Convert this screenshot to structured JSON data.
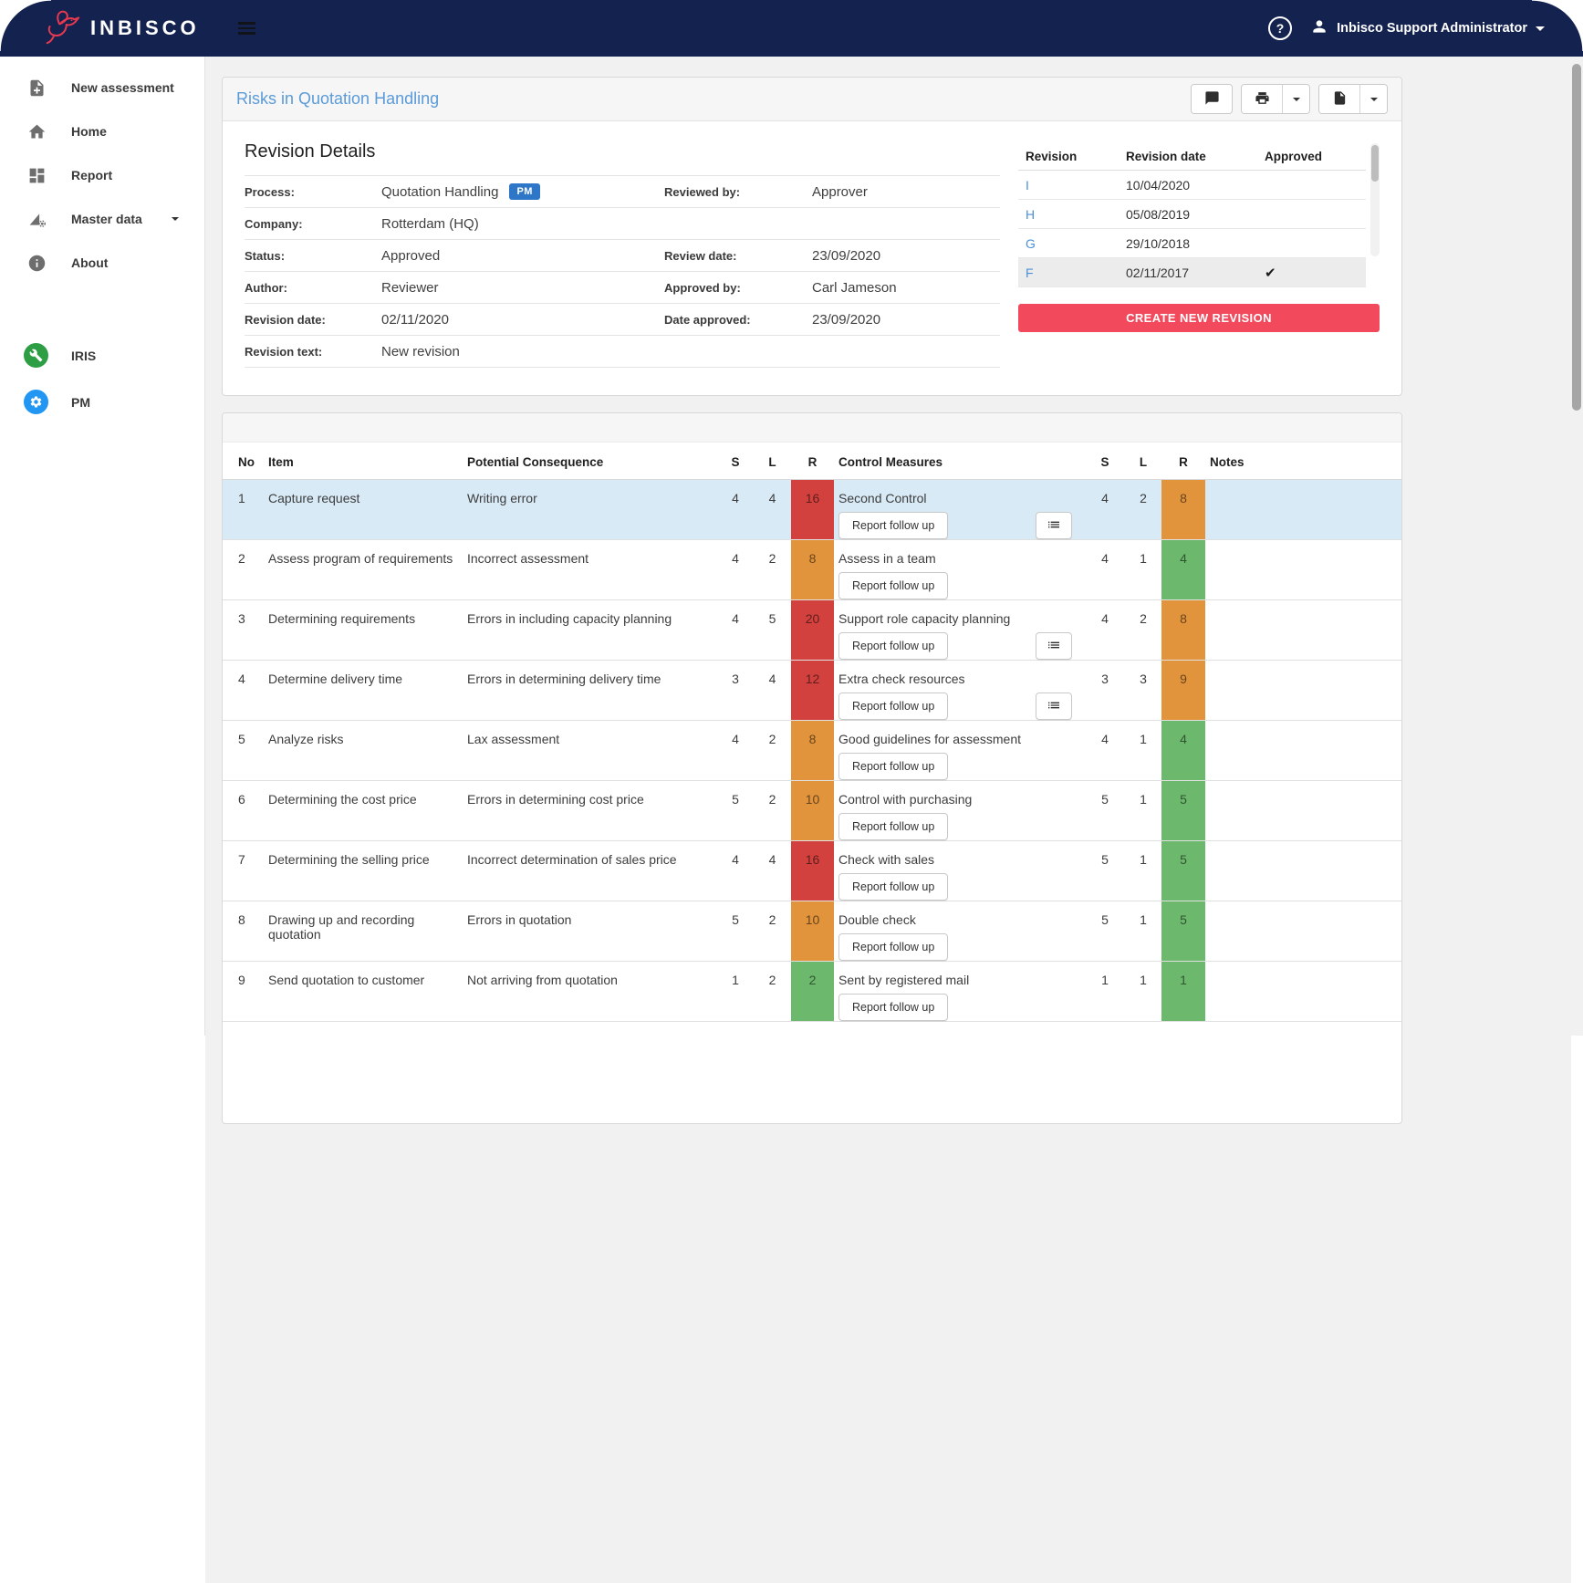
{
  "navbar": {
    "brand": "INBISCO",
    "help_label": "?",
    "user": "Inbisco Support Administrator"
  },
  "sidebar": {
    "items": [
      {
        "label": "New assessment",
        "icon": "note-add"
      },
      {
        "label": "Home",
        "icon": "home"
      },
      {
        "label": "Report",
        "icon": "dashboard"
      },
      {
        "label": "Master data",
        "icon": "data-gear",
        "caret": true
      },
      {
        "label": "About",
        "icon": "info"
      }
    ],
    "apps": [
      {
        "label": "IRIS",
        "icon": "wrench",
        "color": "#2e9e44"
      },
      {
        "label": "PM",
        "icon": "gear",
        "color": "#2196f3"
      }
    ]
  },
  "page": {
    "title": "Risks in Quotation Handling"
  },
  "toolbar_icons": [
    "comment-icon",
    "print-icon",
    "print-dropdown",
    "file-icon",
    "file-dropdown"
  ],
  "revision_details": {
    "heading": "Revision Details",
    "left": [
      {
        "label": "Process:",
        "value": "Quotation Handling",
        "badge": "PM"
      },
      {
        "label": "Company:",
        "value": "Rotterdam (HQ)"
      },
      {
        "label": "Status:",
        "value": "Approved"
      },
      {
        "label": "Author:",
        "value": "Reviewer"
      },
      {
        "label": "Revision date:",
        "value": "02/11/2020"
      },
      {
        "label": "Revision text:",
        "value": "New revision"
      }
    ],
    "right": [
      {
        "label": "Reviewed by:",
        "value": "Approver"
      },
      {
        "label": "",
        "value": ""
      },
      {
        "label": "Review date:",
        "value": "23/09/2020"
      },
      {
        "label": "Approved by:",
        "value": "Carl Jameson"
      },
      {
        "label": "Date approved:",
        "value": "23/09/2020"
      },
      {
        "label": "",
        "value": ""
      }
    ]
  },
  "revision_history": {
    "columns": [
      "Revision",
      "Revision date",
      "Approved"
    ],
    "rows": [
      {
        "revision": "I",
        "date": "10/04/2020",
        "approved": false,
        "selected": false
      },
      {
        "revision": "H",
        "date": "05/08/2019",
        "approved": false,
        "selected": false
      },
      {
        "revision": "G",
        "date": "29/10/2018",
        "approved": false,
        "selected": false
      },
      {
        "revision": "F",
        "date": "02/11/2017",
        "approved": true,
        "selected": true
      }
    ],
    "create_button": "CREATE NEW REVISION"
  },
  "risk_table": {
    "columns": [
      "No",
      "Item",
      "Potential Consequence",
      "S",
      "L",
      "R",
      "Control Measures",
      "S",
      "L",
      "R",
      "Notes"
    ],
    "report_button": "Report follow up",
    "rows": [
      {
        "no": "1",
        "item": "Capture request",
        "consequence": "Writing error",
        "s1": "4",
        "l1": "4",
        "r1": "16",
        "r1_level": "red",
        "control": "Second Control",
        "has_list": true,
        "s2": "4",
        "l2": "2",
        "r2": "8",
        "r2_level": "orange",
        "highlighted": true
      },
      {
        "no": "2",
        "item": "Assess program of requirements",
        "consequence": "Incorrect assessment",
        "s1": "4",
        "l1": "2",
        "r1": "8",
        "r1_level": "orange",
        "control": "Assess in a team",
        "has_list": false,
        "s2": "4",
        "l2": "1",
        "r2": "4",
        "r2_level": "green",
        "highlighted": false
      },
      {
        "no": "3",
        "item": "Determining requirements",
        "consequence": "Errors in including capacity planning",
        "s1": "4",
        "l1": "5",
        "r1": "20",
        "r1_level": "red",
        "control": "Support role capacity planning",
        "has_list": true,
        "s2": "4",
        "l2": "2",
        "r2": "8",
        "r2_level": "orange",
        "highlighted": false
      },
      {
        "no": "4",
        "item": "Determine delivery time",
        "consequence": "Errors in determining delivery time",
        "s1": "3",
        "l1": "4",
        "r1": "12",
        "r1_level": "red",
        "control": "Extra check resources",
        "has_list": true,
        "s2": "3",
        "l2": "3",
        "r2": "9",
        "r2_level": "orange",
        "highlighted": false
      },
      {
        "no": "5",
        "item": "Analyze risks",
        "consequence": "Lax assessment",
        "s1": "4",
        "l1": "2",
        "r1": "8",
        "r1_level": "orange",
        "control": "Good guidelines for assessment",
        "has_list": false,
        "s2": "4",
        "l2": "1",
        "r2": "4",
        "r2_level": "green",
        "highlighted": false
      },
      {
        "no": "6",
        "item": "Determining the cost price",
        "consequence": "Errors in determining cost price",
        "s1": "5",
        "l1": "2",
        "r1": "10",
        "r1_level": "orange",
        "control": "Control with purchasing",
        "has_list": false,
        "s2": "5",
        "l2": "1",
        "r2": "5",
        "r2_level": "green",
        "highlighted": false
      },
      {
        "no": "7",
        "item": "Determining the selling price",
        "consequence": "Incorrect determination of sales price",
        "s1": "4",
        "l1": "4",
        "r1": "16",
        "r1_level": "red",
        "control": "Check with sales",
        "has_list": false,
        "s2": "5",
        "l2": "1",
        "r2": "5",
        "r2_level": "green",
        "highlighted": false
      },
      {
        "no": "8",
        "item": "Drawing up and recording quotation",
        "consequence": "Errors in quotation",
        "s1": "5",
        "l1": "2",
        "r1": "10",
        "r1_level": "orange",
        "control": "Double check",
        "has_list": false,
        "s2": "5",
        "l2": "1",
        "r2": "5",
        "r2_level": "green",
        "highlighted": false
      },
      {
        "no": "9",
        "item": "Send quotation to customer",
        "consequence": "Not arriving from quotation",
        "s1": "1",
        "l1": "2",
        "r1": "2",
        "r1_level": "green",
        "control": "Sent by registered mail",
        "has_list": false,
        "s2": "1",
        "l2": "1",
        "r2": "1",
        "r2_level": "green",
        "highlighted": false
      }
    ]
  },
  "colors": {
    "navbar_bg": "#14224f",
    "brand_red": "#e63950",
    "title_blue": "#5b9bd8",
    "link_blue": "#4a90d9",
    "badge_blue": "#2e76c8",
    "button_red": "#f2495c",
    "risk_red": "#d3413e",
    "risk_orange": "#e2943c",
    "risk_green": "#6cb86c",
    "row_highlight": "#d8eaf6",
    "iris_green": "#2e9e44",
    "pm_blue": "#2196f3"
  }
}
